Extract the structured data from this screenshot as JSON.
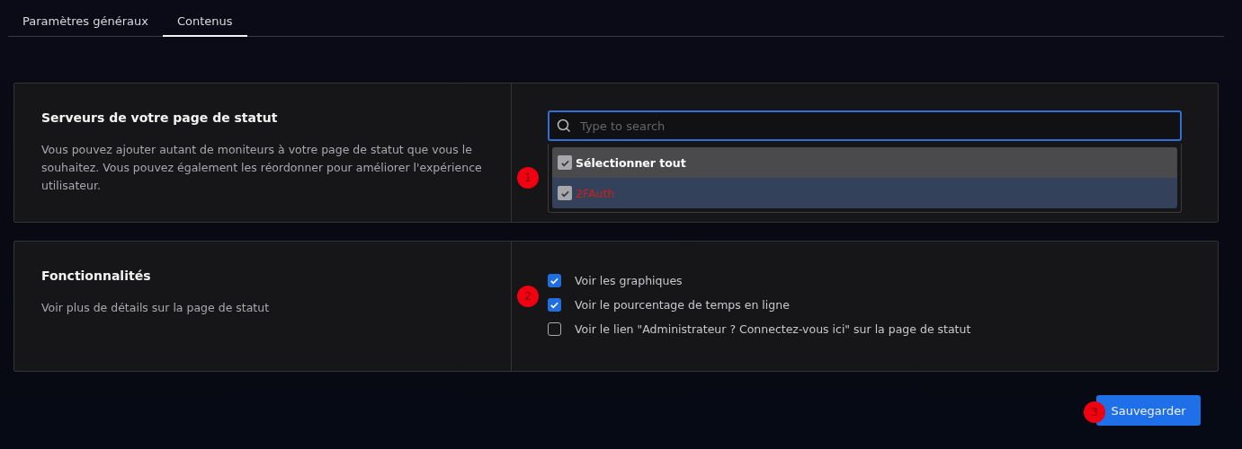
{
  "tabs": [
    {
      "label": "Paramètres généraux",
      "selected": false
    },
    {
      "label": "Contenus",
      "selected": true
    }
  ],
  "servers": {
    "title": "Serveurs de votre page de statut",
    "description": "Vous pouvez ajouter autant de moniteurs à votre page de statut que vous le souhaitez. Vous pouvez également les réordonner pour améliorer l'expérience utilisateur.",
    "marker": "1",
    "search": {
      "placeholder": "Type to search"
    },
    "options": [
      {
        "kind": "select_all",
        "label": "Sélectionner tout",
        "checked": true
      },
      {
        "kind": "monitor",
        "label": "2FAuth",
        "checked": true
      }
    ]
  },
  "features": {
    "title": "Fonctionnalités",
    "description": "Voir plus de détails sur la page de statut",
    "marker": "2",
    "options": [
      {
        "label": "Voir les graphiques",
        "checked": true
      },
      {
        "label": "Voir le pourcentage de temps en ligne",
        "checked": true
      },
      {
        "label": "Voir le lien \"Administrateur ? Connectez-vous ici\" sur la page de statut",
        "checked": false
      }
    ]
  },
  "save": {
    "label": "Sauvegarder",
    "marker": "3"
  }
}
